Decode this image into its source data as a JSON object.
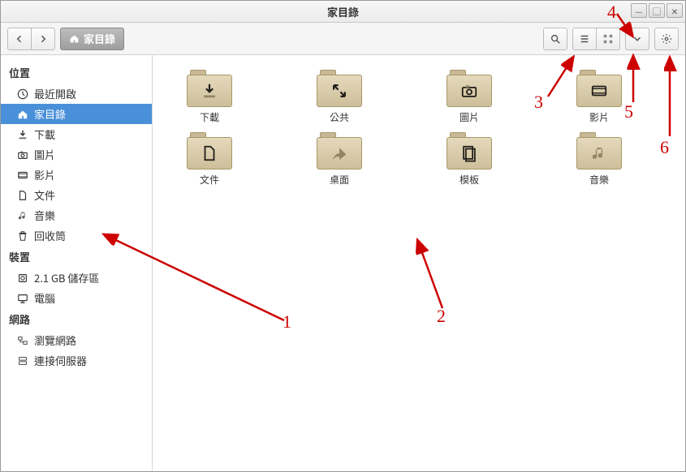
{
  "window": {
    "title": "家目錄"
  },
  "path": {
    "label": "家目錄"
  },
  "sidebar": {
    "sections": [
      {
        "label": "位置",
        "items": [
          {
            "icon": "clock",
            "label": "最近開啟",
            "selected": false
          },
          {
            "icon": "home",
            "label": "家目錄",
            "selected": true
          },
          {
            "icon": "download",
            "label": "下載",
            "selected": false
          },
          {
            "icon": "camera",
            "label": "圖片",
            "selected": false
          },
          {
            "icon": "video",
            "label": "影片",
            "selected": false
          },
          {
            "icon": "document",
            "label": "文件",
            "selected": false
          },
          {
            "icon": "music",
            "label": "音樂",
            "selected": false
          },
          {
            "icon": "trash",
            "label": "回收筒",
            "selected": false
          }
        ]
      },
      {
        "label": "裝置",
        "items": [
          {
            "icon": "disk",
            "label": "2.1 GB 儲存區",
            "selected": false
          },
          {
            "icon": "computer",
            "label": "電腦",
            "selected": false
          }
        ]
      },
      {
        "label": "網路",
        "items": [
          {
            "icon": "network",
            "label": "瀏覽網路",
            "selected": false
          },
          {
            "icon": "server",
            "label": "連接伺服器",
            "selected": false
          }
        ]
      }
    ]
  },
  "folders": [
    {
      "label": "下載",
      "glyph": "download"
    },
    {
      "label": "公共",
      "glyph": "expand"
    },
    {
      "label": "圖片",
      "glyph": "camera"
    },
    {
      "label": "影片",
      "glyph": "video"
    },
    {
      "label": "文件",
      "glyph": "document"
    },
    {
      "label": "桌面",
      "glyph": "desktop"
    },
    {
      "label": "模板",
      "glyph": "template"
    },
    {
      "label": "音樂",
      "glyph": "music"
    }
  ],
  "annotations": {
    "1": "1",
    "2": "2",
    "3": "3",
    "4": "4",
    "5": "5",
    "6": "6"
  }
}
